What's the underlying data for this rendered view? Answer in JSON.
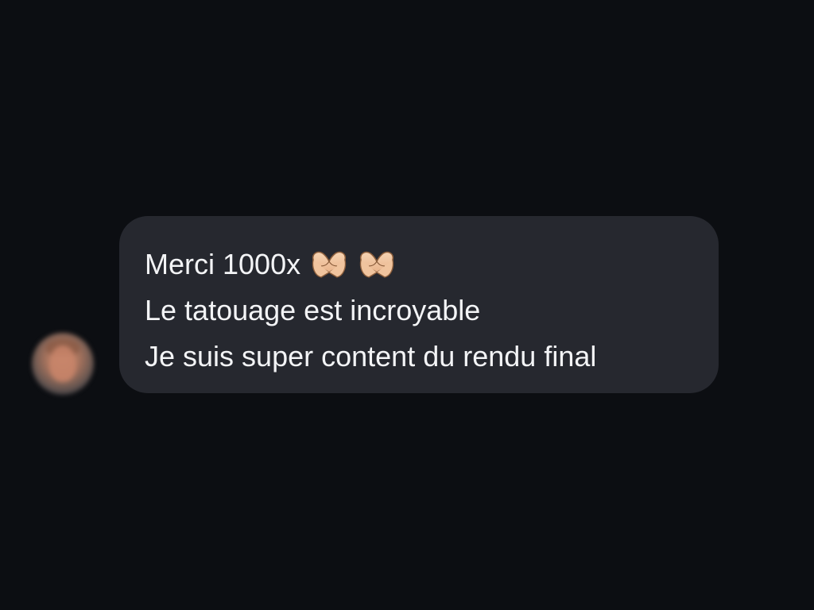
{
  "conversation": {
    "message": {
      "lines": [
        "Merci 1000x",
        "Le tatouage est incroyable",
        "Je suis super content du rendu final"
      ],
      "emoji": [
        "heart-hands-icon",
        "heart-hands-icon"
      ]
    }
  },
  "colors": {
    "background": "#0c0e12",
    "bubble": "#26282f",
    "text": "#f3f4f6",
    "emoji_skin": "#f2c7a1"
  }
}
